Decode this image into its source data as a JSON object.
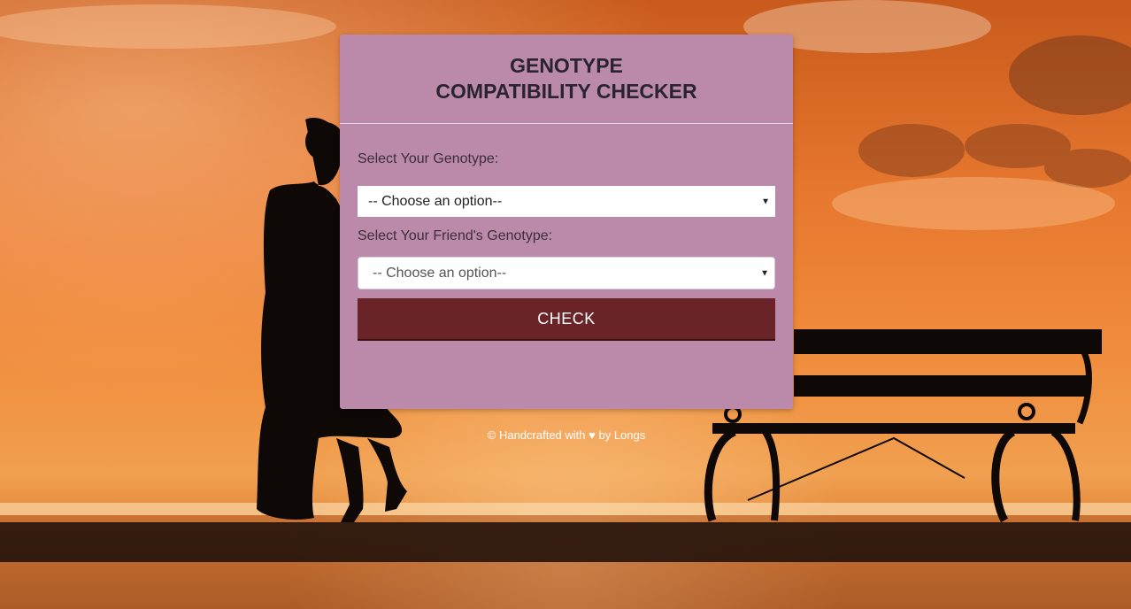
{
  "form": {
    "title_line1": "GENOTYPE",
    "title_line2": "COMPATIBILITY CHECKER",
    "label_your_genotype": "Select Your Genotype:",
    "select_your_genotype": "-- Choose an option--",
    "label_friend_genotype": "Select Your Friend's Genotype:",
    "select_friend_genotype": "-- Choose an option--",
    "check_label": "CHECK"
  },
  "footer": {
    "copyright": "©",
    "handcrafted": "Handcrafted with",
    "heart": "♥",
    "by": "by Longs"
  },
  "icons": {
    "dropdown": "caret-down-icon",
    "love": "heart-icon"
  },
  "colors": {
    "card": "#bb8aab",
    "button": "#6a2428",
    "title": "#2a2430"
  }
}
